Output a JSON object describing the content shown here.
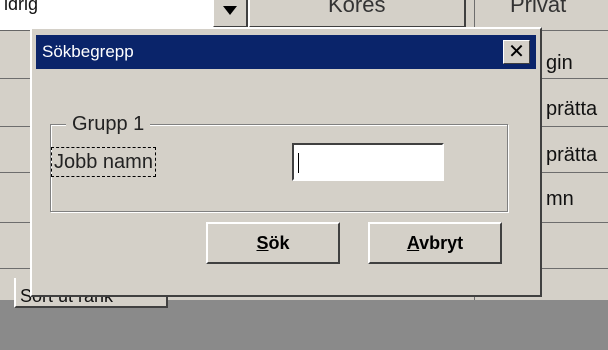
{
  "background": {
    "combo_value": "ldrig",
    "kores_label": "Köres",
    "header_right": "Privat",
    "right_items": [
      "gin",
      "prätta",
      "prätta",
      "mn"
    ],
    "tab_label": "Sort ut rank"
  },
  "dialog": {
    "title": "Sökbegrepp",
    "close_symbol": "✕",
    "group_label": "Grupp 1",
    "field_label": "Jobb namn",
    "field_value": "",
    "search_button": {
      "accel": "S",
      "rest": "ök"
    },
    "cancel_button": {
      "accel": "A",
      "rest": "vbryt"
    }
  },
  "colors": {
    "titlebar": "#0a246a",
    "face": "#d4d0c8",
    "desktop": "#8a8a8a"
  }
}
